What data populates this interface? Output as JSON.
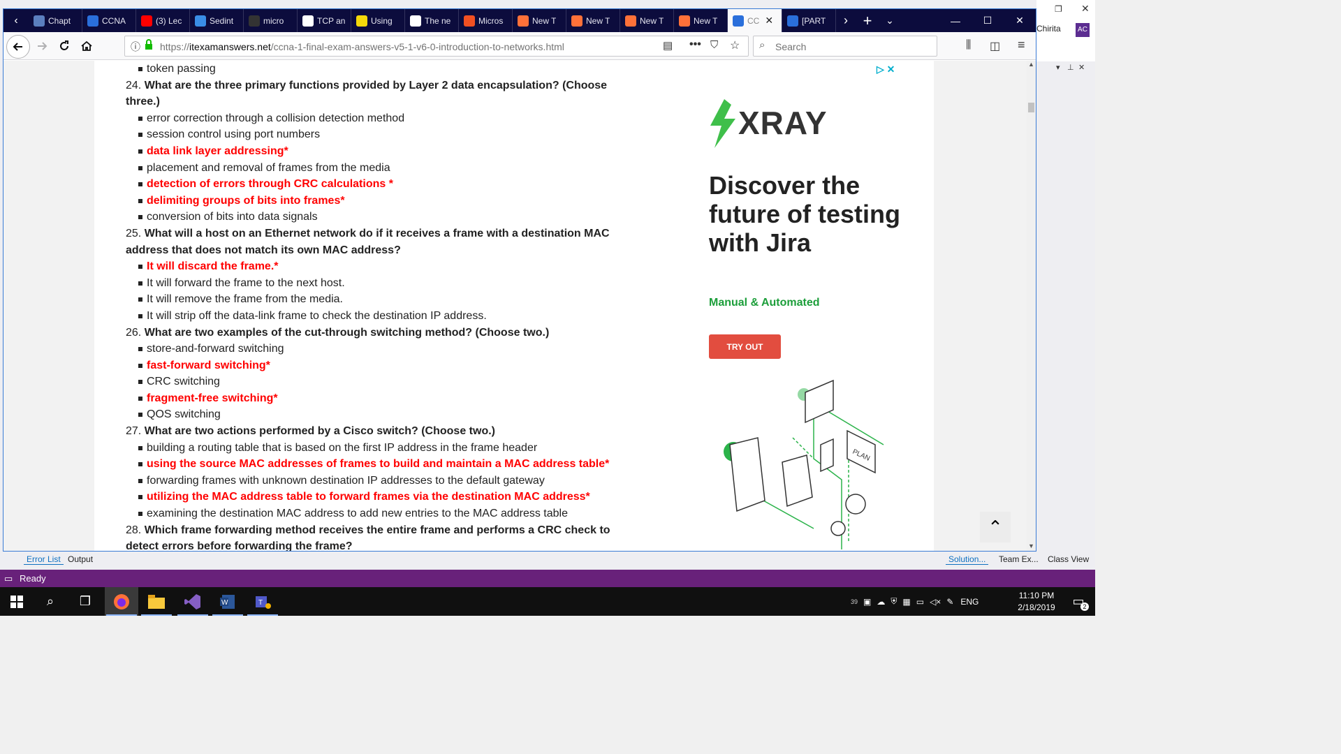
{
  "vs": {
    "user": "Chirita",
    "avatar": "AC",
    "bottom_tabs": [
      "Error List",
      "Output"
    ],
    "bottom_right_tabs": [
      "Solution...",
      "Team Ex...",
      "Class View"
    ],
    "status": "Ready"
  },
  "browser": {
    "tabs": [
      {
        "label": "Chapt",
        "icon": "page-icon",
        "color": "#5b7fbf"
      },
      {
        "label": "CCNA",
        "icon": "itexam-icon",
        "color": "#2a6fdb"
      },
      {
        "label": "(3) Lec",
        "icon": "youtube-icon",
        "color": "#ff0000"
      },
      {
        "label": "Sedint",
        "icon": "d-icon",
        "color": "#3a8ee6"
      },
      {
        "label": "micro",
        "icon": "github-icon",
        "color": "#333333"
      },
      {
        "label": "TCP an",
        "icon": "google-icon",
        "color": "#ffffff"
      },
      {
        "label": "Using",
        "icon": "dictionary-icon",
        "color": "#f5d90a"
      },
      {
        "label": "The ne",
        "icon": "gmail-icon",
        "color": "#ffffff"
      },
      {
        "label": "Micros",
        "icon": "microsoft-icon",
        "color": "#f25022"
      },
      {
        "label": "New T",
        "icon": "firefox-icon",
        "color": "#ff7139"
      },
      {
        "label": "New T",
        "icon": "firefox-icon",
        "color": "#ff7139"
      },
      {
        "label": "New T",
        "icon": "firefox-icon",
        "color": "#ff7139"
      },
      {
        "label": "New T",
        "icon": "firefox-icon",
        "color": "#ff7139"
      },
      {
        "label": "CC",
        "icon": "itexam-icon",
        "color": "#2a6fdb",
        "active": true
      },
      {
        "label": "[PART",
        "icon": "itexam-icon",
        "color": "#2a6fdb"
      }
    ],
    "url_prefix": "https://",
    "url_domain": "itexamanswers.net",
    "url_path": "/ccna-1-final-exam-answers-v5-1-v6-0-introduction-to-networks.html",
    "search_placeholder": "Search"
  },
  "article": {
    "top_item": "token passing",
    "questions": [
      {
        "num": "24.",
        "text": "What are the three primary functions provided by Layer 2 data encapsulation? (Choose three.)",
        "options": [
          {
            "text": "error correction through a collision detection method",
            "correct": false
          },
          {
            "text": "session control using port numbers",
            "correct": false
          },
          {
            "text": "data link layer addressing*",
            "correct": true
          },
          {
            "text": "placement and removal of frames from the media",
            "correct": false
          },
          {
            "text": "detection of errors through CRC calculations *",
            "correct": true
          },
          {
            "text": "delimiting groups of bits into frames*",
            "correct": true
          },
          {
            "text": "conversion of bits into data signals",
            "correct": false
          }
        ]
      },
      {
        "num": "25.",
        "text": "What will a host on an Ethernet network do if it receives a frame with a destination MAC address that does not match its own MAC address?",
        "options": [
          {
            "text": "It will discard the frame.*",
            "correct": true
          },
          {
            "text": "It will forward the frame to the next host.",
            "correct": false
          },
          {
            "text": "It will remove the frame from the media.",
            "correct": false
          },
          {
            "text": "It will strip off the data-link frame to check the destination IP address.",
            "correct": false
          }
        ]
      },
      {
        "num": "26.",
        "text": "What are two examples of the cut-through switching method? (Choose two.)",
        "options": [
          {
            "text": "store-and-forward switching",
            "correct": false
          },
          {
            "text": "fast-forward switching*",
            "correct": true
          },
          {
            "text": "CRC switching",
            "correct": false
          },
          {
            "text": "fragment-free switching*",
            "correct": true
          },
          {
            "text": "QOS switching",
            "correct": false
          }
        ]
      },
      {
        "num": "27.",
        "text": "What are two actions performed by a Cisco switch? (Choose two.)",
        "options": [
          {
            "text": "building a routing table that is based on the first IP address in the frame header",
            "correct": false
          },
          {
            "text": "using the source MAC addresses of frames to build and maintain a MAC address table*",
            "correct": true
          },
          {
            "text": "forwarding frames with unknown destination IP addresses to the default gateway",
            "correct": false
          },
          {
            "text": "utilizing the MAC address table to forward frames via the destination MAC address*",
            "correct": true
          },
          {
            "text": "examining the destination MAC address to add new entries to the MAC address table",
            "correct": false
          }
        ]
      },
      {
        "num": "28.",
        "text": "Which frame forwarding method receives the entire frame and performs a CRC check to detect errors before forwarding the frame?",
        "options": []
      }
    ]
  },
  "ad": {
    "brand": "XRAY",
    "headline": "Discover the future of testing with Jira",
    "subline": "Manual & Automated",
    "cta": "TRY OUT",
    "plan_label": "PLAN"
  },
  "taskbar": {
    "time": "11:10 PM",
    "date": "2/18/2019",
    "lang": "ENG",
    "notif_count": "2",
    "temp": "39"
  }
}
